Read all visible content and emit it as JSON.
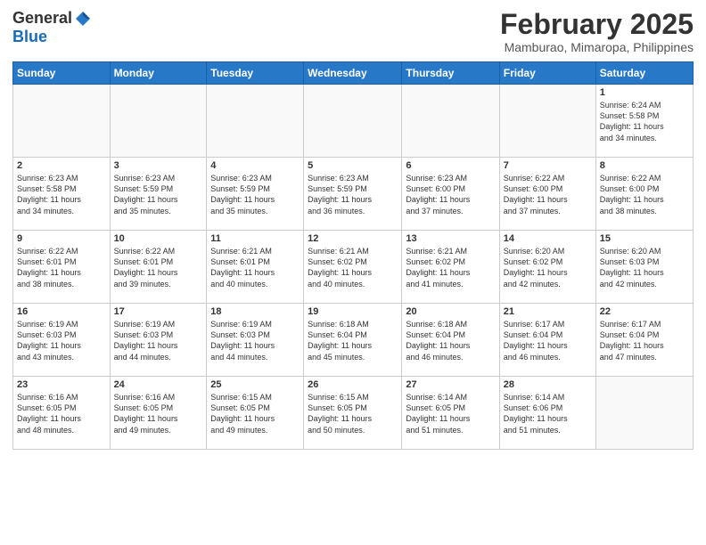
{
  "header": {
    "logo_general": "General",
    "logo_blue": "Blue",
    "month_title": "February 2025",
    "location": "Mamburao, Mimaropa, Philippines"
  },
  "weekdays": [
    "Sunday",
    "Monday",
    "Tuesday",
    "Wednesday",
    "Thursday",
    "Friday",
    "Saturday"
  ],
  "weeks": [
    [
      {
        "day": "",
        "info": ""
      },
      {
        "day": "",
        "info": ""
      },
      {
        "day": "",
        "info": ""
      },
      {
        "day": "",
        "info": ""
      },
      {
        "day": "",
        "info": ""
      },
      {
        "day": "",
        "info": ""
      },
      {
        "day": "1",
        "info": "Sunrise: 6:24 AM\nSunset: 5:58 PM\nDaylight: 11 hours\nand 34 minutes."
      }
    ],
    [
      {
        "day": "2",
        "info": "Sunrise: 6:23 AM\nSunset: 5:58 PM\nDaylight: 11 hours\nand 34 minutes."
      },
      {
        "day": "3",
        "info": "Sunrise: 6:23 AM\nSunset: 5:59 PM\nDaylight: 11 hours\nand 35 minutes."
      },
      {
        "day": "4",
        "info": "Sunrise: 6:23 AM\nSunset: 5:59 PM\nDaylight: 11 hours\nand 35 minutes."
      },
      {
        "day": "5",
        "info": "Sunrise: 6:23 AM\nSunset: 5:59 PM\nDaylight: 11 hours\nand 36 minutes."
      },
      {
        "day": "6",
        "info": "Sunrise: 6:23 AM\nSunset: 6:00 PM\nDaylight: 11 hours\nand 37 minutes."
      },
      {
        "day": "7",
        "info": "Sunrise: 6:22 AM\nSunset: 6:00 PM\nDaylight: 11 hours\nand 37 minutes."
      },
      {
        "day": "8",
        "info": "Sunrise: 6:22 AM\nSunset: 6:00 PM\nDaylight: 11 hours\nand 38 minutes."
      }
    ],
    [
      {
        "day": "9",
        "info": "Sunrise: 6:22 AM\nSunset: 6:01 PM\nDaylight: 11 hours\nand 38 minutes."
      },
      {
        "day": "10",
        "info": "Sunrise: 6:22 AM\nSunset: 6:01 PM\nDaylight: 11 hours\nand 39 minutes."
      },
      {
        "day": "11",
        "info": "Sunrise: 6:21 AM\nSunset: 6:01 PM\nDaylight: 11 hours\nand 40 minutes."
      },
      {
        "day": "12",
        "info": "Sunrise: 6:21 AM\nSunset: 6:02 PM\nDaylight: 11 hours\nand 40 minutes."
      },
      {
        "day": "13",
        "info": "Sunrise: 6:21 AM\nSunset: 6:02 PM\nDaylight: 11 hours\nand 41 minutes."
      },
      {
        "day": "14",
        "info": "Sunrise: 6:20 AM\nSunset: 6:02 PM\nDaylight: 11 hours\nand 42 minutes."
      },
      {
        "day": "15",
        "info": "Sunrise: 6:20 AM\nSunset: 6:03 PM\nDaylight: 11 hours\nand 42 minutes."
      }
    ],
    [
      {
        "day": "16",
        "info": "Sunrise: 6:19 AM\nSunset: 6:03 PM\nDaylight: 11 hours\nand 43 minutes."
      },
      {
        "day": "17",
        "info": "Sunrise: 6:19 AM\nSunset: 6:03 PM\nDaylight: 11 hours\nand 44 minutes."
      },
      {
        "day": "18",
        "info": "Sunrise: 6:19 AM\nSunset: 6:03 PM\nDaylight: 11 hours\nand 44 minutes."
      },
      {
        "day": "19",
        "info": "Sunrise: 6:18 AM\nSunset: 6:04 PM\nDaylight: 11 hours\nand 45 minutes."
      },
      {
        "day": "20",
        "info": "Sunrise: 6:18 AM\nSunset: 6:04 PM\nDaylight: 11 hours\nand 46 minutes."
      },
      {
        "day": "21",
        "info": "Sunrise: 6:17 AM\nSunset: 6:04 PM\nDaylight: 11 hours\nand 46 minutes."
      },
      {
        "day": "22",
        "info": "Sunrise: 6:17 AM\nSunset: 6:04 PM\nDaylight: 11 hours\nand 47 minutes."
      }
    ],
    [
      {
        "day": "23",
        "info": "Sunrise: 6:16 AM\nSunset: 6:05 PM\nDaylight: 11 hours\nand 48 minutes."
      },
      {
        "day": "24",
        "info": "Sunrise: 6:16 AM\nSunset: 6:05 PM\nDaylight: 11 hours\nand 49 minutes."
      },
      {
        "day": "25",
        "info": "Sunrise: 6:15 AM\nSunset: 6:05 PM\nDaylight: 11 hours\nand 49 minutes."
      },
      {
        "day": "26",
        "info": "Sunrise: 6:15 AM\nSunset: 6:05 PM\nDaylight: 11 hours\nand 50 minutes."
      },
      {
        "day": "27",
        "info": "Sunrise: 6:14 AM\nSunset: 6:05 PM\nDaylight: 11 hours\nand 51 minutes."
      },
      {
        "day": "28",
        "info": "Sunrise: 6:14 AM\nSunset: 6:06 PM\nDaylight: 11 hours\nand 51 minutes."
      },
      {
        "day": "",
        "info": ""
      }
    ]
  ]
}
